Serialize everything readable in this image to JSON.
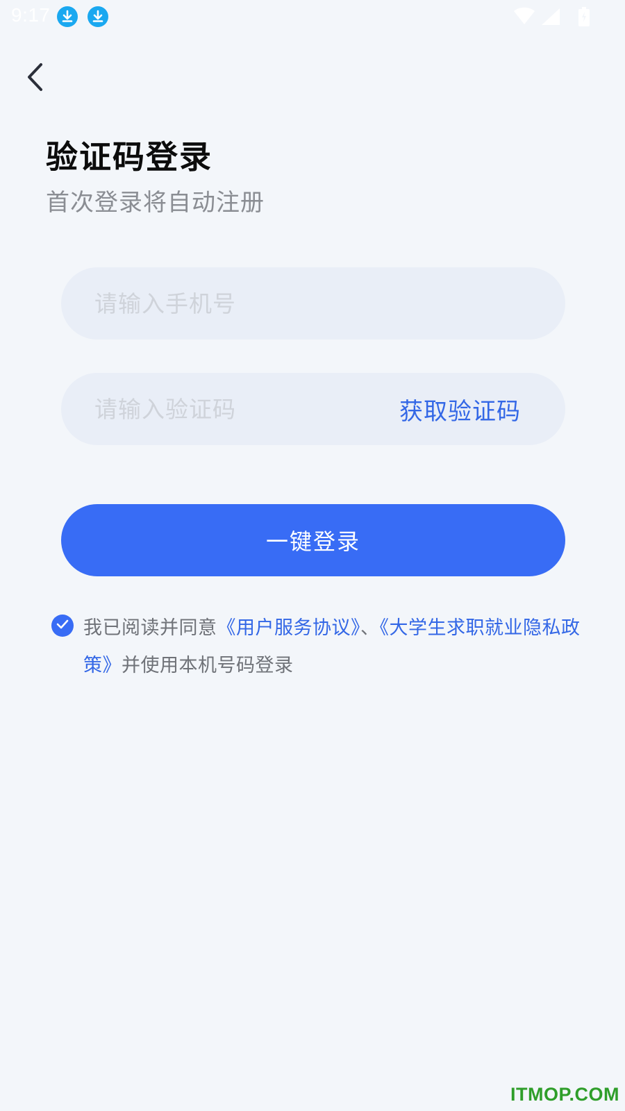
{
  "status_bar": {
    "time": "9:17",
    "icons": [
      "download-icon",
      "download-icon",
      "wifi-icon",
      "signal-icon",
      "battery-icon"
    ],
    "download_icon_color": "#1aa8f0"
  },
  "header": {
    "back_icon": "chevron-left-icon",
    "title": "验证码登录",
    "subtitle": "首次登录将自动注册"
  },
  "form": {
    "phone_placeholder": "请输入手机号",
    "phone_value": "",
    "code_placeholder": "请输入验证码",
    "code_value": "",
    "get_code_label": "获取验证码",
    "login_label": "一键登录"
  },
  "agreement": {
    "checked": true,
    "prefix": "我已阅读并同意",
    "link1": "《用户服务协议》",
    "separator": "、",
    "link2": "《大学生求职就业隐私政策》",
    "suffix": "并使用本机号码登录"
  },
  "watermark": "ITMOP.COM",
  "colors": {
    "background": "#f3f6fa",
    "accent": "#386cf5",
    "link": "#3367e6",
    "input_bg": "#e9eef7",
    "watermark": "#2f9e2a"
  }
}
